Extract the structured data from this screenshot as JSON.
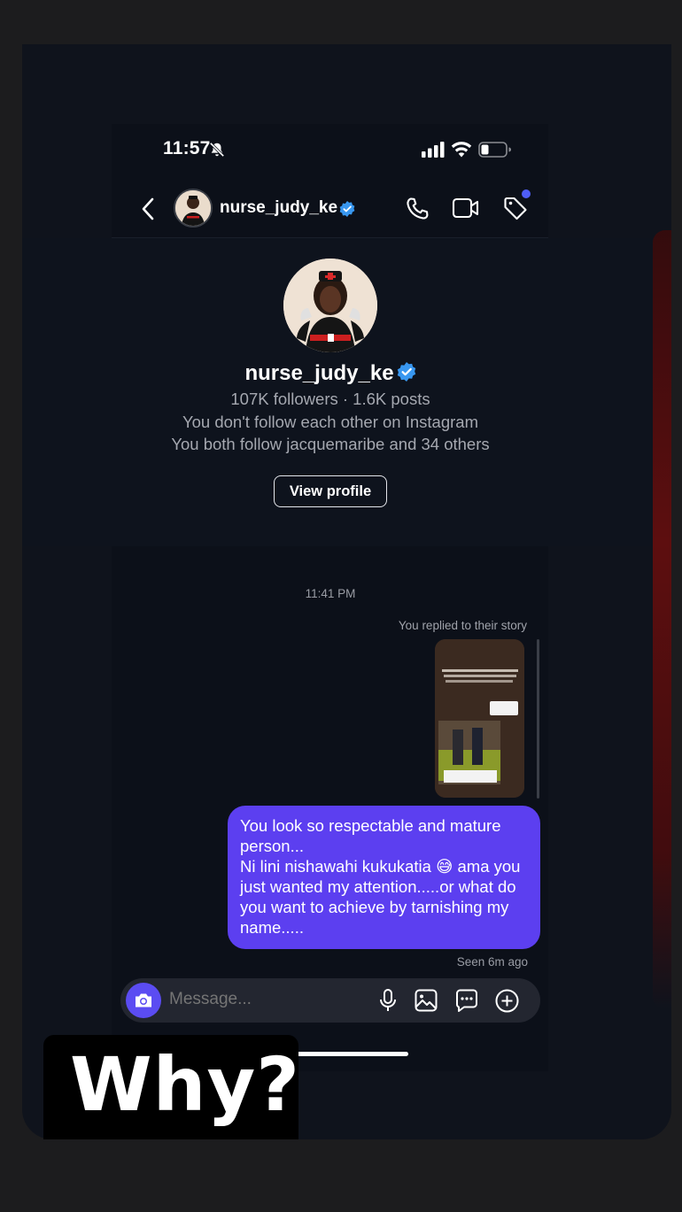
{
  "status_bar": {
    "time": "11:57",
    "icons": [
      "bell-muted-icon",
      "signal-icon",
      "wifi-icon",
      "battery-icon"
    ]
  },
  "header": {
    "username": "nurse_judy_ke",
    "icons": [
      "back-chevron-icon",
      "verified-badge-icon",
      "phone-icon",
      "video-icon",
      "tag-icon"
    ]
  },
  "profile": {
    "username": "nurse_judy_ke",
    "stats": "107K followers · 1.6K posts",
    "follow_status": "You don't follow each other on Instagram",
    "mutual": "You both follow jacquemaribe and 34 others",
    "view_profile_label": "View profile"
  },
  "conversation": {
    "timestamp": "11:41 PM",
    "story_reply_label": "You replied to their story",
    "message_line1": "You look so respectable and mature person...",
    "message_line2": "Ni lini nishawahi kukukatia 😅 ama you just wanted my attention.....or what do you want to achieve by tarnishing my name.....",
    "seen_label": "Seen 6m ago"
  },
  "composer": {
    "placeholder": "Message...",
    "icons": [
      "camera-icon",
      "microphone-icon",
      "gallery-icon",
      "sticker-icon",
      "plus-icon"
    ]
  },
  "overlay": {
    "caption": "Why?"
  },
  "colors": {
    "accent": "#5b4cf2",
    "bubble": "#5c3ff0",
    "verified": "#3897f0",
    "background": "#0f131c"
  }
}
